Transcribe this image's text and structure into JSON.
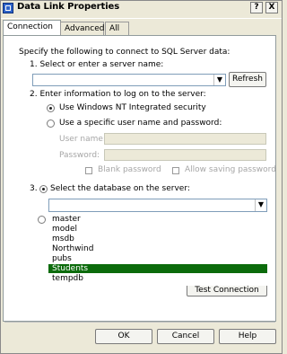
{
  "window": {
    "title": "Data Link Properties",
    "help_glyph": "?",
    "close_glyph": "X"
  },
  "tabs": [
    {
      "label": "Connection",
      "active": true
    },
    {
      "label": "Advanced",
      "active": false
    },
    {
      "label": "All",
      "active": false
    }
  ],
  "connection": {
    "intro": "Specify the following to connect to SQL Server data:",
    "step1": {
      "label": "1. Select or enter a server name:",
      "server_value": "",
      "refresh_label": "Refresh"
    },
    "step2": {
      "label": "2. Enter information to log on to the server:",
      "option_windows": "Use Windows NT Integrated security",
      "option_specific": "Use a specific user name and password:",
      "user_name_label": "User name:",
      "password_label": "Password:",
      "blank_password": "Blank password",
      "allow_saving": "Allow saving password"
    },
    "step3": {
      "number": "3.",
      "option_select_db": "Select the database on the server:",
      "database_value": "",
      "databases": [
        "master",
        "model",
        "msdb",
        "Northwind",
        "pubs",
        "Students",
        "tempdb"
      ],
      "selected_database": "Students",
      "test_connection": "Test Connection"
    }
  },
  "footer": {
    "ok": "OK",
    "cancel": "Cancel",
    "help": "Help"
  }
}
